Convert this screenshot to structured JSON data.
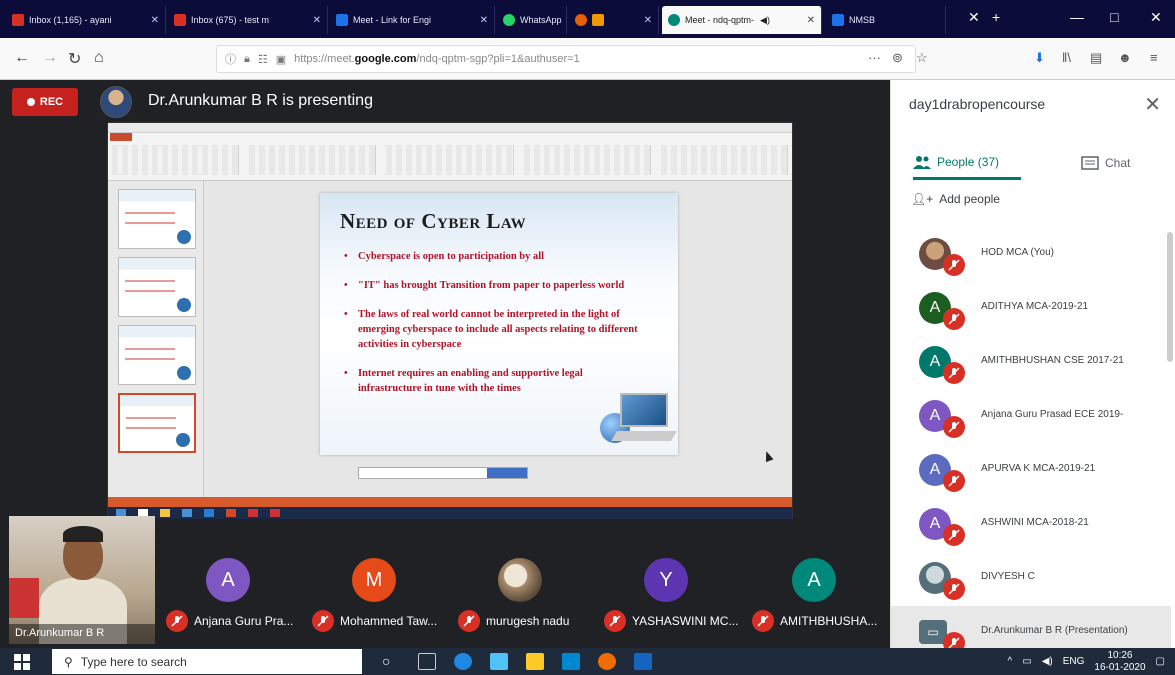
{
  "browser": {
    "tabs": [
      {
        "title": "Inbox (1,165) - ayani",
        "color": "#d93025"
      },
      {
        "title": "Inbox (675) - test m",
        "color": "#d93025"
      },
      {
        "title": "Meet - Link for Engi",
        "color": "#1a73e8"
      },
      {
        "title": "WhatsApp",
        "color": "#25d366"
      },
      {
        "title": "",
        "color": "#f29900"
      },
      {
        "title": "Meet - ndq-qptm-",
        "color": "#00897b"
      },
      {
        "title": "NMSB",
        "color": "#1a73e8"
      }
    ],
    "url_prefix": "https://meet.",
    "url_domain": "google.com",
    "url_suffix": "/ndq-qptm-sgp?pli=1&authuser=1"
  },
  "meet": {
    "rec_label": "REC",
    "presenting_text": "Dr.Arunkumar B R is presenting",
    "slide": {
      "title": "Need of Cyber Law",
      "bullets": [
        "Cyberspace is open to participation by all",
        "\"IT\" has brought Transition from paper to paperless world",
        "The laws of real world cannot be interpreted in the light of emerging cyberspace to include all aspects relating to different activities in cyberspace",
        "Internet requires an enabling and supportive legal infrastructure in tune with the times"
      ]
    },
    "self_name": "Dr.Arunkumar B R",
    "filmstrip": [
      {
        "initial": "A",
        "name": "Anjana Guru Pra...",
        "color": "#7e57c2"
      },
      {
        "initial": "M",
        "name": "Mohammed Taw...",
        "color": "#e64a19"
      },
      {
        "initial": "",
        "name": "murugesh nadu",
        "color": "#8d6e63"
      },
      {
        "initial": "Y",
        "name": "YASHASWINI MC...",
        "color": "#5e35b1"
      },
      {
        "initial": "A",
        "name": "AMITHBHUSHA...",
        "color": "#00897b"
      }
    ]
  },
  "panel": {
    "title": "day1drabropencourse",
    "tab_people": "People (37)",
    "tab_chat": "Chat",
    "add_people": "Add people",
    "participants": [
      {
        "initial": "",
        "name": "HOD MCA (You)",
        "color": "#8d6e63"
      },
      {
        "initial": "A",
        "name": "ADITHYA MCA-2019-21",
        "color": "#1b5e20"
      },
      {
        "initial": "A",
        "name": "AMITHBHUSHAN CSE 2017-21",
        "color": "#00796b"
      },
      {
        "initial": "A",
        "name": "Anjana Guru Prasad ECE 2019-",
        "color": "#7e57c2"
      },
      {
        "initial": "A",
        "name": "APURVA K MCA-2019-21",
        "color": "#5c6bc0"
      },
      {
        "initial": "A",
        "name": "ASHWINI MCA-2018-21",
        "color": "#7e57c2"
      },
      {
        "initial": "",
        "name": "DIVYESH C",
        "color": "#78909c"
      },
      {
        "initial": "",
        "name": "Dr.Arunkumar B R (Presentation)",
        "color": "#546e7a"
      }
    ]
  },
  "taskbar": {
    "search_placeholder": "Type here to search",
    "lang": "ENG",
    "time": "10:26",
    "date": "16-01-2020"
  }
}
